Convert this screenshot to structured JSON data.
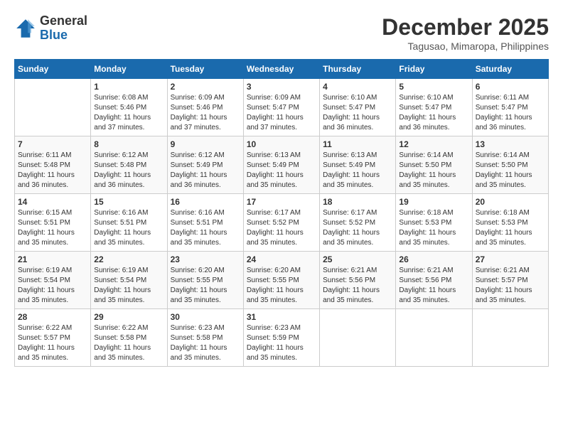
{
  "logo": {
    "line1": "General",
    "line2": "Blue"
  },
  "title": "December 2025",
  "location": "Tagusao, Mimaropa, Philippines",
  "days_of_week": [
    "Sunday",
    "Monday",
    "Tuesday",
    "Wednesday",
    "Thursday",
    "Friday",
    "Saturday"
  ],
  "weeks": [
    [
      {
        "day": "",
        "sunrise": "",
        "sunset": "",
        "daylight": ""
      },
      {
        "day": "1",
        "sunrise": "Sunrise: 6:08 AM",
        "sunset": "Sunset: 5:46 PM",
        "daylight": "Daylight: 11 hours and 37 minutes."
      },
      {
        "day": "2",
        "sunrise": "Sunrise: 6:09 AM",
        "sunset": "Sunset: 5:46 PM",
        "daylight": "Daylight: 11 hours and 37 minutes."
      },
      {
        "day": "3",
        "sunrise": "Sunrise: 6:09 AM",
        "sunset": "Sunset: 5:47 PM",
        "daylight": "Daylight: 11 hours and 37 minutes."
      },
      {
        "day": "4",
        "sunrise": "Sunrise: 6:10 AM",
        "sunset": "Sunset: 5:47 PM",
        "daylight": "Daylight: 11 hours and 36 minutes."
      },
      {
        "day": "5",
        "sunrise": "Sunrise: 6:10 AM",
        "sunset": "Sunset: 5:47 PM",
        "daylight": "Daylight: 11 hours and 36 minutes."
      },
      {
        "day": "6",
        "sunrise": "Sunrise: 6:11 AM",
        "sunset": "Sunset: 5:47 PM",
        "daylight": "Daylight: 11 hours and 36 minutes."
      }
    ],
    [
      {
        "day": "7",
        "sunrise": "Sunrise: 6:11 AM",
        "sunset": "Sunset: 5:48 PM",
        "daylight": "Daylight: 11 hours and 36 minutes."
      },
      {
        "day": "8",
        "sunrise": "Sunrise: 6:12 AM",
        "sunset": "Sunset: 5:48 PM",
        "daylight": "Daylight: 11 hours and 36 minutes."
      },
      {
        "day": "9",
        "sunrise": "Sunrise: 6:12 AM",
        "sunset": "Sunset: 5:49 PM",
        "daylight": "Daylight: 11 hours and 36 minutes."
      },
      {
        "day": "10",
        "sunrise": "Sunrise: 6:13 AM",
        "sunset": "Sunset: 5:49 PM",
        "daylight": "Daylight: 11 hours and 35 minutes."
      },
      {
        "day": "11",
        "sunrise": "Sunrise: 6:13 AM",
        "sunset": "Sunset: 5:49 PM",
        "daylight": "Daylight: 11 hours and 35 minutes."
      },
      {
        "day": "12",
        "sunrise": "Sunrise: 6:14 AM",
        "sunset": "Sunset: 5:50 PM",
        "daylight": "Daylight: 11 hours and 35 minutes."
      },
      {
        "day": "13",
        "sunrise": "Sunrise: 6:14 AM",
        "sunset": "Sunset: 5:50 PM",
        "daylight": "Daylight: 11 hours and 35 minutes."
      }
    ],
    [
      {
        "day": "14",
        "sunrise": "Sunrise: 6:15 AM",
        "sunset": "Sunset: 5:51 PM",
        "daylight": "Daylight: 11 hours and 35 minutes."
      },
      {
        "day": "15",
        "sunrise": "Sunrise: 6:16 AM",
        "sunset": "Sunset: 5:51 PM",
        "daylight": "Daylight: 11 hours and 35 minutes."
      },
      {
        "day": "16",
        "sunrise": "Sunrise: 6:16 AM",
        "sunset": "Sunset: 5:51 PM",
        "daylight": "Daylight: 11 hours and 35 minutes."
      },
      {
        "day": "17",
        "sunrise": "Sunrise: 6:17 AM",
        "sunset": "Sunset: 5:52 PM",
        "daylight": "Daylight: 11 hours and 35 minutes."
      },
      {
        "day": "18",
        "sunrise": "Sunrise: 6:17 AM",
        "sunset": "Sunset: 5:52 PM",
        "daylight": "Daylight: 11 hours and 35 minutes."
      },
      {
        "day": "19",
        "sunrise": "Sunrise: 6:18 AM",
        "sunset": "Sunset: 5:53 PM",
        "daylight": "Daylight: 11 hours and 35 minutes."
      },
      {
        "day": "20",
        "sunrise": "Sunrise: 6:18 AM",
        "sunset": "Sunset: 5:53 PM",
        "daylight": "Daylight: 11 hours and 35 minutes."
      }
    ],
    [
      {
        "day": "21",
        "sunrise": "Sunrise: 6:19 AM",
        "sunset": "Sunset: 5:54 PM",
        "daylight": "Daylight: 11 hours and 35 minutes."
      },
      {
        "day": "22",
        "sunrise": "Sunrise: 6:19 AM",
        "sunset": "Sunset: 5:54 PM",
        "daylight": "Daylight: 11 hours and 35 minutes."
      },
      {
        "day": "23",
        "sunrise": "Sunrise: 6:20 AM",
        "sunset": "Sunset: 5:55 PM",
        "daylight": "Daylight: 11 hours and 35 minutes."
      },
      {
        "day": "24",
        "sunrise": "Sunrise: 6:20 AM",
        "sunset": "Sunset: 5:55 PM",
        "daylight": "Daylight: 11 hours and 35 minutes."
      },
      {
        "day": "25",
        "sunrise": "Sunrise: 6:21 AM",
        "sunset": "Sunset: 5:56 PM",
        "daylight": "Daylight: 11 hours and 35 minutes."
      },
      {
        "day": "26",
        "sunrise": "Sunrise: 6:21 AM",
        "sunset": "Sunset: 5:56 PM",
        "daylight": "Daylight: 11 hours and 35 minutes."
      },
      {
        "day": "27",
        "sunrise": "Sunrise: 6:21 AM",
        "sunset": "Sunset: 5:57 PM",
        "daylight": "Daylight: 11 hours and 35 minutes."
      }
    ],
    [
      {
        "day": "28",
        "sunrise": "Sunrise: 6:22 AM",
        "sunset": "Sunset: 5:57 PM",
        "daylight": "Daylight: 11 hours and 35 minutes."
      },
      {
        "day": "29",
        "sunrise": "Sunrise: 6:22 AM",
        "sunset": "Sunset: 5:58 PM",
        "daylight": "Daylight: 11 hours and 35 minutes."
      },
      {
        "day": "30",
        "sunrise": "Sunrise: 6:23 AM",
        "sunset": "Sunset: 5:58 PM",
        "daylight": "Daylight: 11 hours and 35 minutes."
      },
      {
        "day": "31",
        "sunrise": "Sunrise: 6:23 AM",
        "sunset": "Sunset: 5:59 PM",
        "daylight": "Daylight: 11 hours and 35 minutes."
      },
      {
        "day": "",
        "sunrise": "",
        "sunset": "",
        "daylight": ""
      },
      {
        "day": "",
        "sunrise": "",
        "sunset": "",
        "daylight": ""
      },
      {
        "day": "",
        "sunrise": "",
        "sunset": "",
        "daylight": ""
      }
    ]
  ]
}
